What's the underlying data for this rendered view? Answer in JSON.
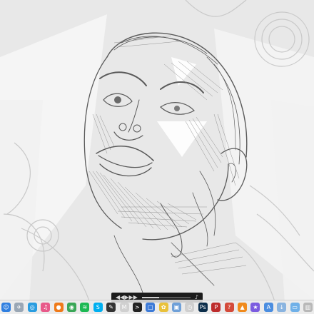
{
  "media_bar": {
    "prev_glyph": "◀◀",
    "play_glyph": "▶",
    "next_glyph": "▶▶",
    "volume_glyph": "♪",
    "progress_fraction": 0.35
  },
  "dock": {
    "icons": [
      {
        "name": "finder-icon",
        "color": "#2f7fe0",
        "glyph": "☺"
      },
      {
        "name": "launchpad-icon",
        "color": "#9aa7b5",
        "glyph": "✈"
      },
      {
        "name": "safari-icon",
        "color": "#2a9de0",
        "glyph": "◎"
      },
      {
        "name": "itunes-icon",
        "color": "#e85a8a",
        "glyph": "♫"
      },
      {
        "name": "firefox-icon",
        "color": "#ef7a1a",
        "glyph": "●"
      },
      {
        "name": "chrome-icon",
        "color": "#3aa757",
        "glyph": "◉"
      },
      {
        "name": "spotify-icon",
        "color": "#1db954",
        "glyph": "≋"
      },
      {
        "name": "skype-icon",
        "color": "#00aff0",
        "glyph": "S"
      },
      {
        "name": "sketchbook-icon",
        "color": "#333333",
        "glyph": "✎"
      },
      {
        "name": "gmail-icon",
        "color": "#d0d0d0",
        "glyph": "M"
      },
      {
        "name": "terminal-icon",
        "color": "#222222",
        "glyph": ">"
      },
      {
        "name": "screenshot-icon",
        "color": "#3d7bd8",
        "glyph": "□"
      },
      {
        "name": "photos-icon",
        "color": "#e9c13a",
        "glyph": "✿"
      },
      {
        "name": "preview-icon",
        "color": "#6fa0d8",
        "glyph": "▣"
      },
      {
        "name": "clock-icon",
        "color": "#cfcfcf",
        "glyph": "◷"
      },
      {
        "name": "photoshop-icon",
        "color": "#0b2d4a",
        "glyph": "Ps"
      },
      {
        "name": "pinterest-icon",
        "color": "#bd2c2c",
        "glyph": "P"
      },
      {
        "name": "help-icon",
        "color": "#d44a3a",
        "glyph": "?"
      },
      {
        "name": "vlc-icon",
        "color": "#f08a1c",
        "glyph": "▲"
      },
      {
        "name": "imovie-icon",
        "color": "#7b5ce0",
        "glyph": "★"
      },
      {
        "name": "app-store-icon",
        "color": "#4a8de0",
        "glyph": "A"
      },
      {
        "name": "downloads-icon",
        "color": "#8ab4e0",
        "glyph": "↓"
      },
      {
        "name": "folder-icon",
        "color": "#6fb0e8",
        "glyph": "▭"
      },
      {
        "name": "trash-icon",
        "color": "#b8b8b8",
        "glyph": "▥"
      }
    ]
  }
}
